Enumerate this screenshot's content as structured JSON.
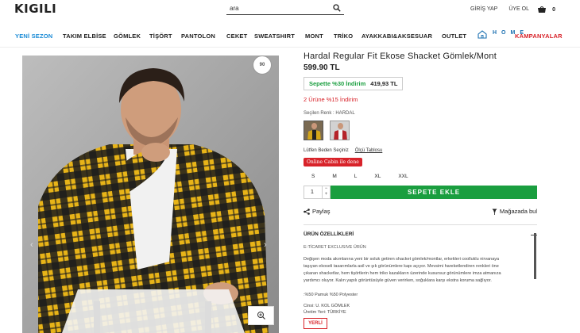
{
  "header": {
    "logo": "KIGILI",
    "search_placeholder": "ara",
    "login": "GİRİŞ YAP",
    "signup": "ÜYE OL",
    "cart_count": "0"
  },
  "nav": {
    "items": [
      {
        "label": "YENİ SEZON"
      },
      {
        "label": "TAKIM ELBİSE"
      },
      {
        "label": "GÖMLEK"
      },
      {
        "label": "TİŞÖRT"
      },
      {
        "label": "PANTOLON"
      },
      {
        "label": "CEKET"
      },
      {
        "label": "SWEATSHIRT"
      },
      {
        "label": "MONT"
      },
      {
        "label": "TRİKO"
      },
      {
        "label": "AYAKKABI&AKSESUAR"
      },
      {
        "label": "OUTLET"
      }
    ],
    "home_label": "HOME",
    "campaigns": "KAMPANYALAR"
  },
  "product": {
    "title": "Hardal Regular Fit Ekose Shacket Gömlek/Mont",
    "price": "599.90 TL",
    "cart_discount_label": "Sepette %30 İndirim",
    "cart_discount_price": "419,93 TL",
    "multi_discount": "2 Ürüne %15 İndirim",
    "color_label": "Seçilen Renk : HARDAL",
    "size_prompt": "Lütfen Beden Seçiniz",
    "size_chart": "Ölçü Tablosu",
    "cabin_label": "Online Cabin ile dene",
    "sizes": [
      "S",
      "M",
      "L",
      "XL",
      "XXL"
    ],
    "quantity": "1",
    "add_to_cart": "SEPETE EKLE",
    "share": "Paylaş",
    "find_in_store": "Mağazada bul"
  },
  "features": {
    "heading": "ÜRÜN ÖZELLİKLERİ",
    "subheading": "E-TİCARET EXCLUSIVE ÜRÜN",
    "description": "Değişen moda akımlarına yeni bir soluk getiren shacket gömlek/montlar, erkekleri coolluklu nirvanaya taşıyan ekoseli tasarımlarla asil ve şık görünümlere kapı açıyor. Mevsimi hareketlendiren renkleri öne çıkaran shacketlar, hem tişörtlerin hem triko kazakların üzerinde kusursuz görünümlere imza atmanıza yardımcı oluyor. Kalın yapılı görüntüsüyle güven verirken, soğuklara karşı ekstra koruma sağlıyor.",
    "material": ":%50 Pamuk %50 Polyester",
    "type": "Cinsi: U. KOL GÖMLEK",
    "origin": "Üretim Yeri: TÜRKİYE",
    "yerli_badge": "YERLİ"
  },
  "colors": {
    "accent_blue": "#1a8bd6",
    "red": "#d8232a",
    "green": "#1a9e3f"
  }
}
